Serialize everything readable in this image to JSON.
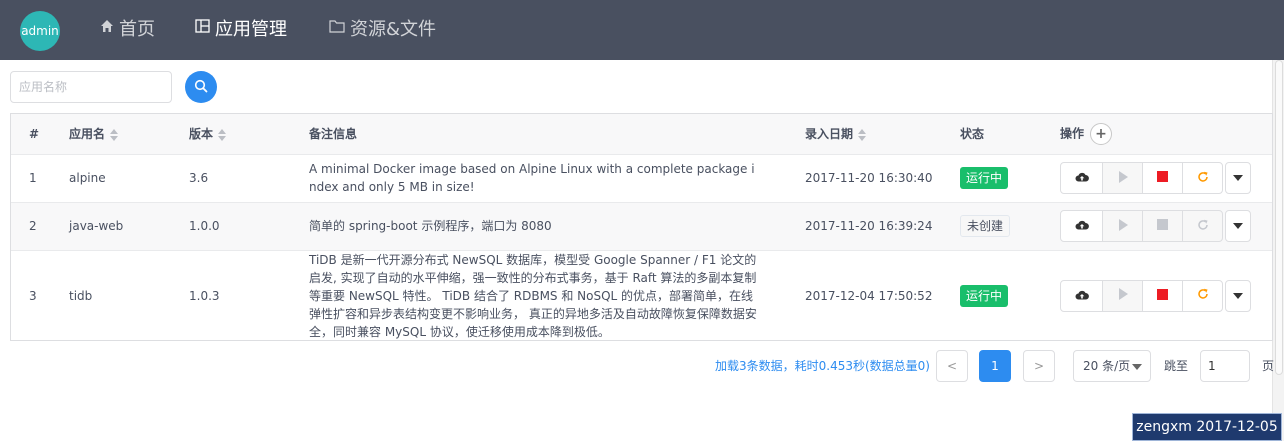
{
  "header": {
    "avatar_text": "admin",
    "nav": [
      {
        "label": "首页",
        "icon": "home-icon"
      },
      {
        "label": "应用管理",
        "icon": "grid-icon"
      },
      {
        "label": "资源&文件",
        "icon": "folder-icon"
      }
    ]
  },
  "search": {
    "placeholder": "应用名称",
    "value": ""
  },
  "table": {
    "columns": [
      "#",
      "应用名",
      "版本",
      "备注信息",
      "录入日期",
      "状态",
      "操作"
    ],
    "rows": [
      {
        "index": "1",
        "name": "alpine",
        "version": "3.6",
        "remark": "A minimal Docker image based on Alpine Linux with a complete package index and only 5 MB in size!",
        "date": "2017-11-20 16:30:40",
        "status": "运行中"
      },
      {
        "index": "2",
        "name": "java-web",
        "version": "1.0.0",
        "remark": "简单的 spring-boot 示例程序，端口为 8080",
        "date": "2017-11-20 16:39:24",
        "status": "未创建"
      },
      {
        "index": "3",
        "name": "tidb",
        "version": "1.0.3",
        "remark": "TiDB 是新一代开源分布式 NewSQL 数据库，模型受 Google Spanner / F1 论文的启发, 实现了自动的水平伸缩，强一致性的分布式事务，基于 Raft 算法的多副本复制等重要 NewSQL 特性。 TiDB 结合了 RDBMS 和 NoSQL 的优点，部署简单，在线弹性扩容和异步表结构变更不影响业务， 真正的异地多活及自动故障恢复保障数据安全，同时兼容 MySQL 协议，使迁移使用成本降到极低。",
        "date": "2017-12-04 17:50:52",
        "status": "运行中"
      }
    ]
  },
  "pagination": {
    "info": "加载3条数据，耗时0.453秒(数据总量0)",
    "prev": "<",
    "current": "1",
    "next": ">",
    "page_size": "20 条/页",
    "jump_label": "跳至",
    "jump_value": "1",
    "page_unit": "页"
  },
  "watermark": "zengxm 2017-12-05",
  "colors": {
    "header_bg": "#495060",
    "primary": "#2d8cf0",
    "success": "#19be6b",
    "stop_red": "#ed1c24",
    "restart_orange": "#ff9900"
  }
}
